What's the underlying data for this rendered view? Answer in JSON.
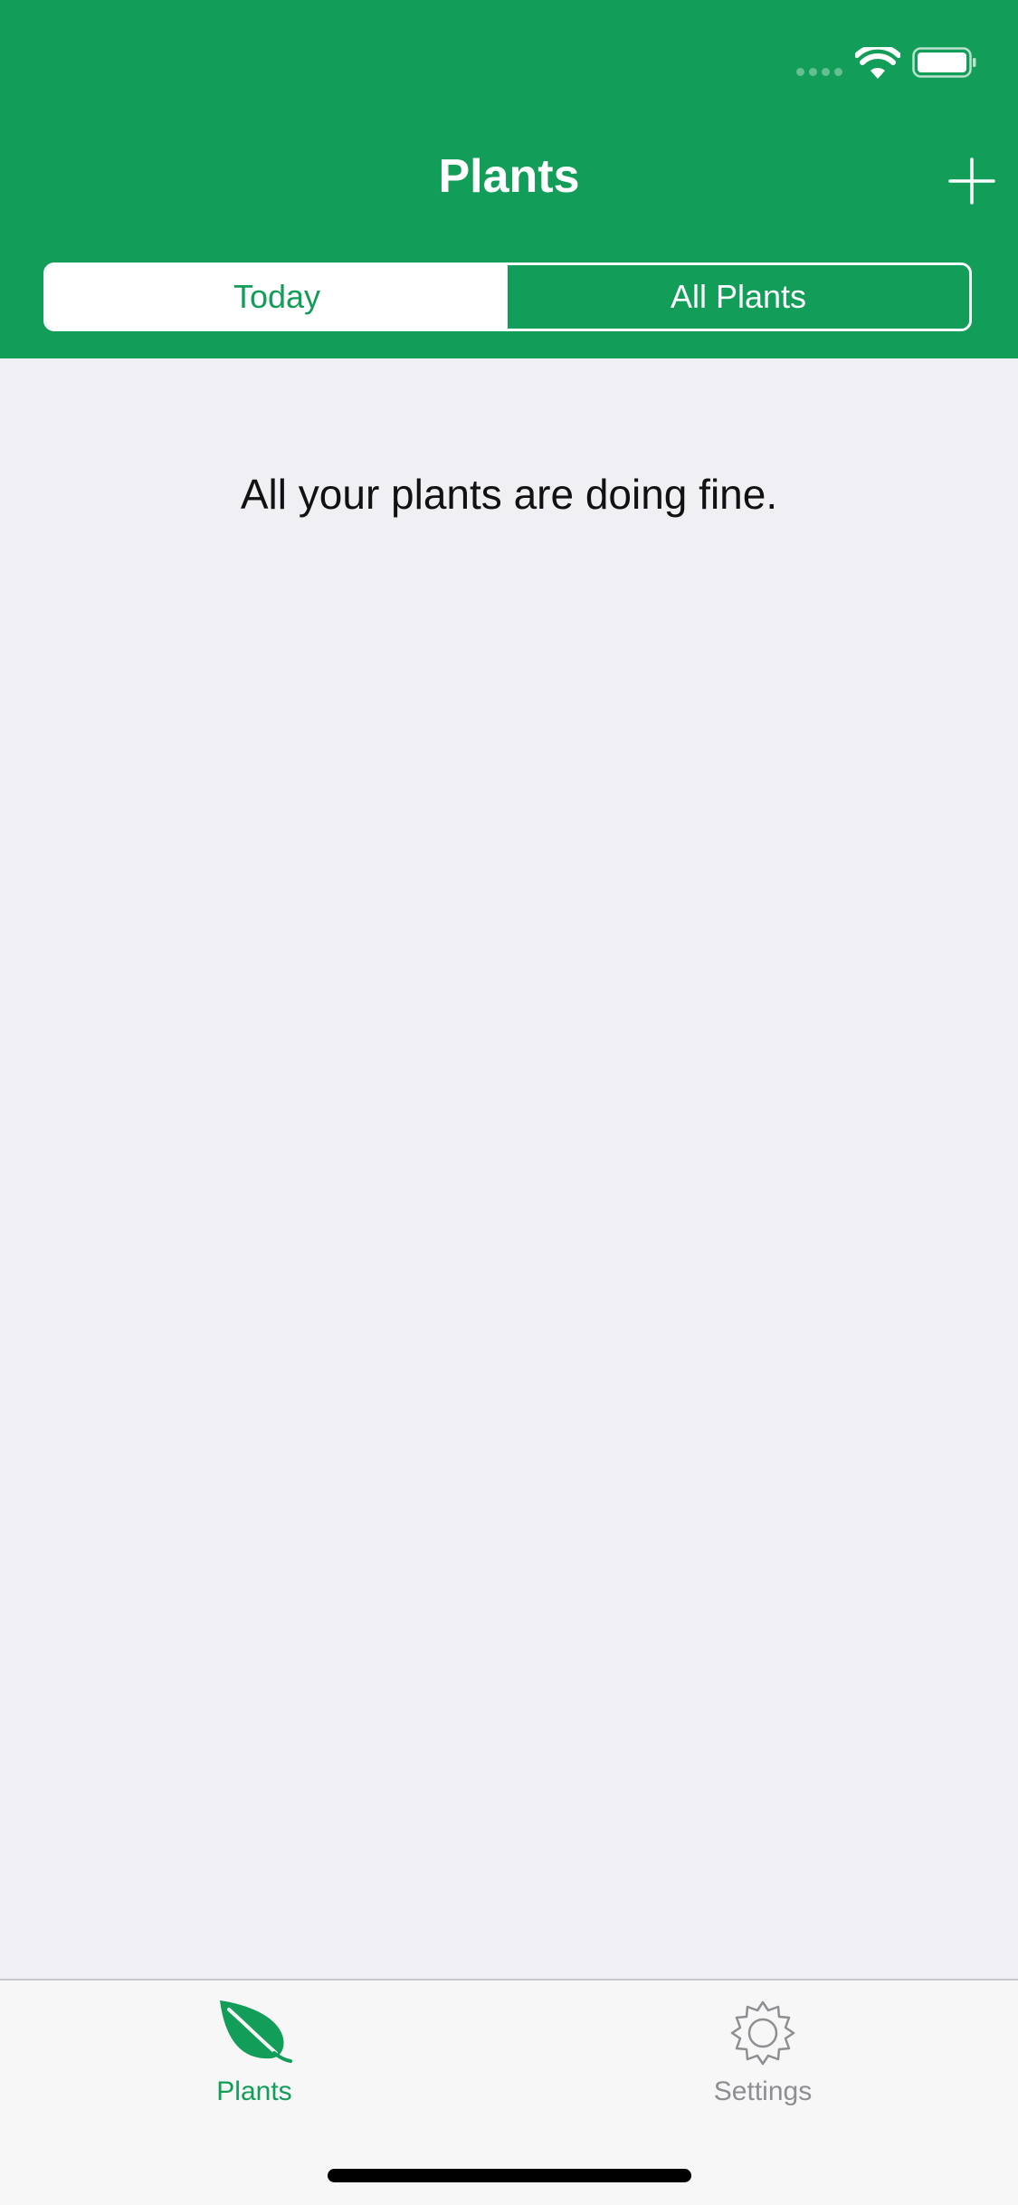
{
  "colors": {
    "accent": "#129d58",
    "background": "#efeff4",
    "tab_bar_background": "#f7f7f7",
    "inactive_tab": "#8e8e93"
  },
  "status_bar": {
    "icons": [
      "cellular-signal-icon",
      "wifi-icon",
      "battery-icon"
    ]
  },
  "nav": {
    "title": "Plants",
    "add_icon": "plus-icon"
  },
  "segmented_control": {
    "selected": "Today",
    "segments": [
      "Today",
      "All Plants"
    ]
  },
  "content": {
    "empty_message": "All your plants are doing fine."
  },
  "tab_bar": {
    "selected": "Plants",
    "items": [
      {
        "label": "Plants",
        "icon": "leaf-icon"
      },
      {
        "label": "Settings",
        "icon": "gear-icon"
      }
    ]
  }
}
